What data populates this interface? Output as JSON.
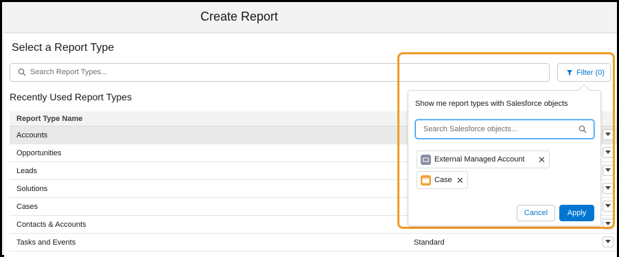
{
  "window": {
    "title": "Create Report"
  },
  "main": {
    "section_title": "Select a Report Type",
    "search": {
      "placeholder": "Search Report Types..."
    },
    "filter_button": {
      "label": "Filter (0)"
    },
    "recent_title": "Recently Used Report Types",
    "table": {
      "columns": [
        "Report Type Name"
      ],
      "rows": [
        {
          "name": "Accounts",
          "selected": true,
          "category": ""
        },
        {
          "name": "Opportunities",
          "category": ""
        },
        {
          "name": "Leads",
          "category": ""
        },
        {
          "name": "Solutions",
          "category": ""
        },
        {
          "name": "Cases",
          "category": ""
        },
        {
          "name": "Contacts & Accounts",
          "category": ""
        },
        {
          "name": "Tasks and Events",
          "category": "Standard"
        }
      ]
    }
  },
  "filter_popover": {
    "title": "Show me report types with Salesforce objects",
    "search_placeholder": "Search Salesforce objects...",
    "pills": [
      {
        "label": "External Managed Account",
        "icon": "external-object-icon",
        "icon_color": "#8a8fa6"
      },
      {
        "label": "Case",
        "icon": "case-icon",
        "icon_color": "#f2a23a"
      }
    ],
    "cancel_label": "Cancel",
    "apply_label": "Apply"
  },
  "colors": {
    "brand": "#0176d3",
    "highlight": "#f09a26"
  }
}
